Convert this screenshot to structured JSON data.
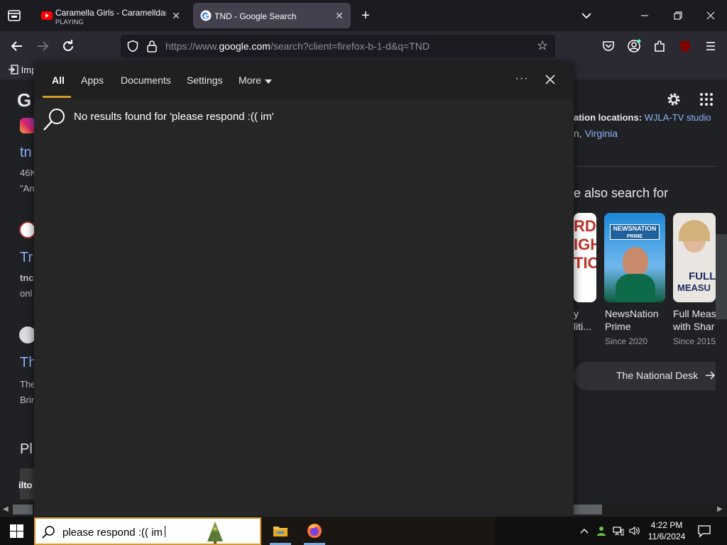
{
  "browser": {
    "tabs": [
      {
        "title": "Caramella Girls - Caramelldans",
        "subtitle": "PLAYING",
        "active": false
      },
      {
        "title": "TND - Google Search",
        "active": true
      }
    ],
    "new_tab_label": "+",
    "url_prefix": "https://www.",
    "url_domain": "google.com",
    "url_rest": "/search?client=firefox-b-1-d&q=TND",
    "extension_badge": "26",
    "bookmark_label": "Imp"
  },
  "google_page": {
    "logo_letter": "G",
    "left_fragments": [
      "tn",
      "46K",
      "\"An",
      "Tr",
      "tnc",
      "onl",
      "Th",
      "The",
      "Brin",
      "Pl",
      "ilto"
    ],
    "right_snippet_bold": "ation locations:",
    "right_snippet_link": "WJLA-TV studio",
    "right_snippet_line2_prefix": "n, ",
    "right_snippet_line2_link": "Virginia",
    "also_search_heading": "e also search for",
    "cards": [
      {
        "name_line1": "y",
        "name_line2": "liti...",
        "since": ""
      },
      {
        "name_line1": "NewsNation",
        "name_line2": "Prime",
        "since": "Since 2020",
        "image_text_top": "NEWSNATION",
        "image_text_sub": "PRIME"
      },
      {
        "name_line1": "Full Meas",
        "name_line2": "with Shar",
        "since": "Since 2015",
        "image_text_top": "FULL",
        "image_text_sub": "MEASU"
      }
    ],
    "card0_image_text": "RDA\nIGH\nTIO",
    "bottom_link": "The National Desk"
  },
  "search_popup": {
    "tabs": [
      {
        "label": "All",
        "active": true
      },
      {
        "label": "Apps"
      },
      {
        "label": "Documents"
      },
      {
        "label": "Settings"
      },
      {
        "label": "More"
      }
    ],
    "options_label": "···",
    "no_results_text": "No results found for 'please respond :(( im'"
  },
  "taskbar": {
    "search_query": "please respond :(( im",
    "time": "4:22 PM",
    "date": "11/6/2024"
  },
  "colors": {
    "accent": "#d49a2a",
    "link": "#8ab4f8",
    "popup_bg": "#262626"
  }
}
